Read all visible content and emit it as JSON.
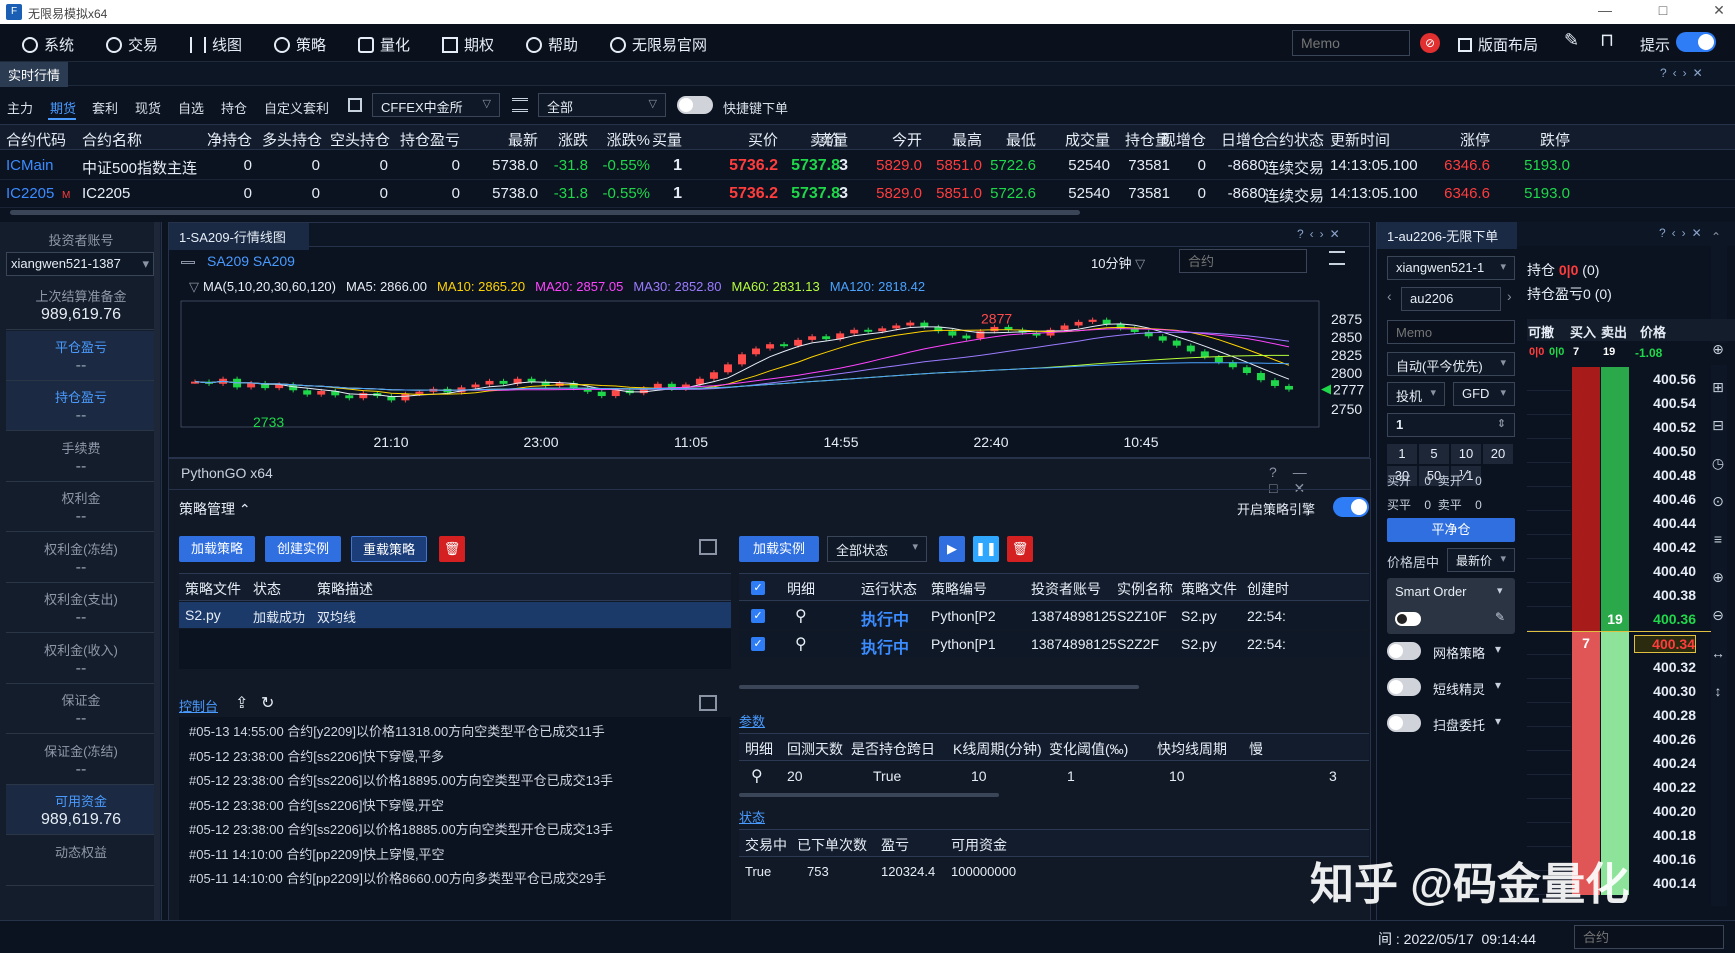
{
  "window": {
    "title": "无限易模拟x64",
    "minimize": "—",
    "maximize": "□",
    "close": "✕"
  },
  "menu": {
    "items": [
      "系统",
      "交易",
      "线图",
      "策略",
      "量化",
      "期权",
      "帮助",
      "无限易官网"
    ],
    "memo_placeholder": "Memo",
    "layout": "版面布局",
    "hint": "提示"
  },
  "tab": {
    "active": "实时行情"
  },
  "filter": {
    "tabs": [
      "主力",
      "期货",
      "套利",
      "现货",
      "自选",
      "持仓",
      "自定义套利"
    ],
    "selected": "期货",
    "exchange": "CFFEX中金所",
    "category": "全部",
    "quick_order": "快捷键下单"
  },
  "quote_table": {
    "headers": [
      "合约代码",
      "合约名称",
      "净持仓",
      "多头持仓",
      "空头持仓",
      "持仓盈亏",
      "最新",
      "涨跌",
      "涨跌%",
      "买量",
      "买价",
      "卖价",
      "卖量",
      "今开",
      "最高",
      "最低",
      "成交量",
      "持仓量",
      "现增仓",
      "日增仓",
      "合约状态",
      "更新时间",
      "涨停",
      "跌停"
    ],
    "rows": [
      [
        "ICMain",
        "中证500指数主连",
        "0",
        "0",
        "0",
        "0",
        "5738.0",
        "-31.8",
        "-0.55%",
        "1",
        "5736.2",
        "5737.8",
        "3",
        "5829.0",
        "5851.0",
        "5722.6",
        "52540",
        "73581",
        "0",
        "-8680",
        "连续交易",
        "14:13:05.100",
        "6346.6",
        "5193.0"
      ],
      [
        "IC2205",
        "IC2205",
        "0",
        "0",
        "0",
        "0",
        "5738.0",
        "-31.8",
        "-0.55%",
        "1",
        "5736.2",
        "5737.8",
        "3",
        "5829.0",
        "5851.0",
        "5722.6",
        "52540",
        "73581",
        "0",
        "-8680",
        "连续交易",
        "14:13:05.100",
        "6346.6",
        "5193.0"
      ]
    ],
    "row2_badge": "M"
  },
  "sidebar": {
    "account_label": "投资者账号",
    "account": "xiangwen521-1387",
    "items": [
      {
        "label": "上次结算准备金",
        "value": "989,619.76"
      },
      {
        "label": "平仓盈亏",
        "value": "--"
      },
      {
        "label": "持仓盈亏",
        "value": "--"
      },
      {
        "label": "手续费",
        "value": "--"
      },
      {
        "label": "权利金",
        "value": "--"
      },
      {
        "label": "权利金(冻结)",
        "value": "--"
      },
      {
        "label": "权利金(支出)",
        "value": "--"
      },
      {
        "label": "权利金(收入)",
        "value": "--"
      },
      {
        "label": "保证金",
        "value": "--"
      },
      {
        "label": "保证金(冻结)",
        "value": "--"
      },
      {
        "label": "可用资金",
        "value": "989,619.76"
      },
      {
        "label": "动态权益",
        "value": ""
      }
    ]
  },
  "chart_panel": {
    "title": "1-SA209-行情线图",
    "symbol": "SA209 SA209",
    "period": "10分钟",
    "contract_placeholder": "合约",
    "ma_line": [
      {
        "text": "MA(5,10,20,30,60,120)",
        "color": "#e6edf6"
      },
      {
        "text": "MA5: 2866.00",
        "color": "#e6edf6"
      },
      {
        "text": "MA10: 2865.20",
        "color": "#ffd400"
      },
      {
        "text": "MA20: 2857.05",
        "color": "#ff44ff"
      },
      {
        "text": "MA30: 2852.80",
        "color": "#9b7cff"
      },
      {
        "text": "MA60: 2831.13",
        "color": "#b6ff3a"
      },
      {
        "text": "MA120: 2818.42",
        "color": "#4aa3ff"
      }
    ]
  },
  "chart_data": {
    "type": "line",
    "title": "SA209 SA209",
    "x_ticks": [
      "21:10",
      "23:00",
      "11:05",
      "14:55",
      "22:40",
      "10:45"
    ],
    "y_ticks": [
      2875,
      2850,
      2825,
      2800,
      2750
    ],
    "ylim": [
      2725,
      2900
    ],
    "annotations": [
      {
        "text": "2877",
        "value": 2877
      },
      {
        "text": "2733",
        "value": 2733
      }
    ],
    "last_price": 2777,
    "closes": [
      2788,
      2785,
      2792,
      2780,
      2786,
      2779,
      2784,
      2776,
      2770,
      2775,
      2769,
      2765,
      2772,
      2768,
      2762,
      2771,
      2774,
      2778,
      2773,
      2780,
      2784,
      2789,
      2785,
      2792,
      2788,
      2782,
      2786,
      2779,
      2774,
      2768,
      2776,
      2772,
      2779,
      2785,
      2778,
      2784,
      2792,
      2801,
      2812,
      2826,
      2834,
      2840,
      2838,
      2846,
      2851,
      2847,
      2855,
      2860,
      2858,
      2862,
      2866,
      2870,
      2864,
      2858,
      2852,
      2848,
      2858,
      2864,
      2860,
      2856,
      2852,
      2860,
      2866,
      2871,
      2874,
      2868,
      2862,
      2857,
      2851,
      2845,
      2838,
      2830,
      2822,
      2815,
      2808,
      2800,
      2790,
      2782,
      2777
    ],
    "grid": false
  },
  "python_panel": {
    "title": "PythonGO x64",
    "strategy_mgmt": "策略管理",
    "engine": "开启策略引擎",
    "buttons_left": [
      "加载策略",
      "创建实例",
      "重载策略"
    ],
    "strategy_table": {
      "headers": [
        "策略文件",
        "状态",
        "策略描述"
      ],
      "rows": [
        [
          "S2.py",
          "加载成功",
          "双均线"
        ]
      ]
    },
    "console_label": "控制台",
    "logs": [
      "#05-13 14:55:00 合约[y2209]以价格11318.00方向空类型平仓已成交11手",
      "#05-12 23:38:00 合约[ss2206]快下穿慢,平多",
      "#05-12 23:38:00 合约[ss2206]以价格18895.00方向空类型平仓已成交13手",
      "#05-12 23:38:00 合约[ss2206]快下穿慢,开空",
      "#05-12 23:38:00 合约[ss2206]以价格18885.00方向空类型开仓已成交13手",
      "#05-11 14:10:00 合约[pp2209]快上穿慢,平空",
      "#05-11 14:10:00 合约[pp2209]以价格8660.00方向多类型平仓已成交29手"
    ],
    "load_instance": "加载实例",
    "status_filter": "全部状态",
    "instance_table": {
      "headers": [
        "明细",
        "运行状态",
        "策略编号",
        "投资者账号",
        "实例名称",
        "策略文件",
        "创建时"
      ],
      "rows": [
        [
          "执行中",
          "Python[P2",
          "13874898125",
          "S2Z10F",
          "S2.py",
          "22:54:"
        ],
        [
          "执行中",
          "Python[P1",
          "13874898125",
          "S2Z2F",
          "S2.py",
          "22:54:"
        ]
      ]
    },
    "params_label": "参数",
    "params_table": {
      "headers": [
        "明细",
        "回测天数",
        "是否持仓跨日",
        "K线周期(分钟)",
        "变化阈值(‰)",
        "快均线周期",
        "慢"
      ],
      "row": [
        "20",
        "True",
        "10",
        "1",
        "10",
        "3"
      ]
    },
    "state_label": "状态",
    "state_table": {
      "headers": [
        "交易中",
        "已下单次数",
        "盈亏",
        "可用资金"
      ],
      "row": [
        "True",
        "753",
        "120324.4",
        "100000000"
      ]
    }
  },
  "order_panel": {
    "title": "1-au2206-无限下单",
    "account": "xiangwen521-1",
    "position_label": "持仓",
    "position_value": "0|0",
    "position_paren": "(0)",
    "pnl_label": "持仓盈亏",
    "pnl_value": "0",
    "pnl_paren": "(0)",
    "contract": "au2206",
    "memo_placeholder": "Memo",
    "auto_mode": "自动(平今优先)",
    "hedge": "投机",
    "tif": "GFD",
    "qty": "1",
    "qty_buttons": [
      "1",
      "5",
      "10",
      "20",
      "30",
      "50",
      "⅟1"
    ],
    "ratio": "1",
    "kai": [
      {
        "label": "买开",
        "value": "0"
      },
      {
        "label": "卖开",
        "value": "0"
      }
    ],
    "ping": [
      {
        "label": "买平",
        "value": "0"
      },
      {
        "label": "卖平",
        "value": "0"
      }
    ],
    "flat_button": "平净仓",
    "price_center_label": "价格居中",
    "price_center_value": "最新价",
    "smart_order": "Smart Order",
    "options": [
      "网格策略",
      "短线精灵",
      "扫盘委托"
    ],
    "dom_headers": [
      "可撤",
      "买入",
      "卖出",
      "价格"
    ],
    "dom_header_vals": [
      "0|0",
      "0|0",
      "7",
      "19",
      "-1.08"
    ],
    "prices": [
      "400.56",
      "400.54",
      "400.52",
      "400.50",
      "400.48",
      "400.46",
      "400.44",
      "400.42",
      "400.40",
      "400.38",
      "400.36",
      "400.34",
      "400.32",
      "400.30",
      "400.28",
      "400.26",
      "400.24",
      "400.22",
      "400.20",
      "400.18",
      "400.16",
      "400.14"
    ],
    "ask_qty": "19",
    "bid_qty": "7"
  },
  "status_bar": {
    "time": "间 : 2022/05/17  09:14:44",
    "contract_placeholder": "合约"
  },
  "watermark": "知乎 @码金量化"
}
